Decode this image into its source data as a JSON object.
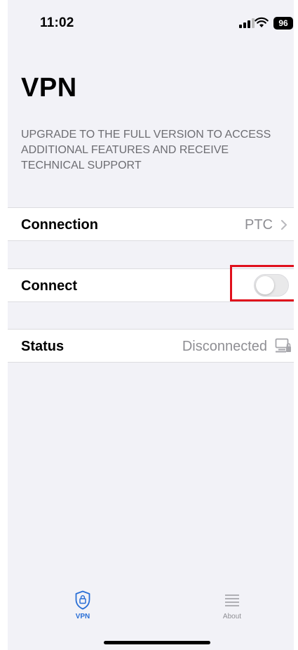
{
  "status_bar": {
    "time": "11:02",
    "battery": "96",
    "icons": [
      "signal-icon",
      "wifi-icon",
      "battery-icon"
    ]
  },
  "page": {
    "title": "VPN",
    "upgrade_note": "UPGRADE TO THE FULL VERSION TO ACCESS ADDITIONAL FEATURES AND RECEIVE TECHNICAL SUPPORT"
  },
  "connection_row": {
    "label": "Connection",
    "value": "PTC",
    "icon": "chevron-right-icon"
  },
  "connect_row": {
    "label": "Connect",
    "toggle_on": false
  },
  "status_row": {
    "label": "Status",
    "value": "Disconnected",
    "icon": "computer-lock-icon"
  },
  "tab_bar": {
    "tabs": [
      {
        "label": "VPN",
        "icon": "shield-lock-icon",
        "active": true
      },
      {
        "label": "About",
        "icon": "list-icon",
        "active": false
      }
    ]
  },
  "colors": {
    "background": "#f2f2f7",
    "accent": "#2a6fd6",
    "highlight": "#e0101c",
    "secondary_text": "#8e8e93"
  }
}
